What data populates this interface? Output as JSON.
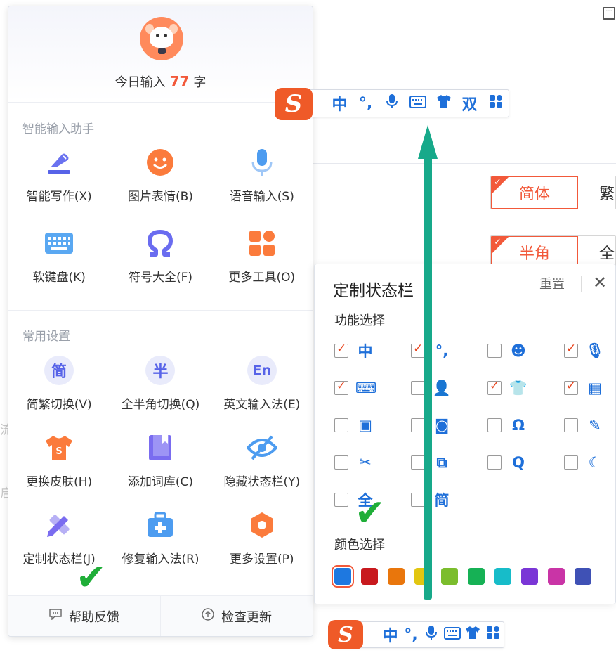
{
  "background": {
    "simp_trad": {
      "active": "简体",
      "inactive": "繁"
    },
    "half_full": {
      "active": "半角",
      "inactive": "全"
    },
    "edge_texts": [
      "流",
      "启"
    ]
  },
  "menu": {
    "today_prefix": "今日输入",
    "today_count": "77",
    "today_suffix": "字",
    "assistant_title": "智能输入助手",
    "assistant_tools": [
      {
        "label": "智能写作(X)",
        "icon": "pen-icon"
      },
      {
        "label": "图片表情(B)",
        "icon": "smiley-icon"
      },
      {
        "label": "语音输入(S)",
        "icon": "microphone-icon"
      },
      {
        "label": "软键盘(K)",
        "icon": "keyboard-icon"
      },
      {
        "label": "符号大全(F)",
        "icon": "omega-icon"
      },
      {
        "label": "更多工具(O)",
        "icon": "grid-icon"
      }
    ],
    "settings_title": "常用设置",
    "settings_tools": [
      {
        "label": "简繁切换(V)",
        "icon_text": "简"
      },
      {
        "label": "全半角切换(Q)",
        "icon_text": "半"
      },
      {
        "label": "英文输入法(E)",
        "icon_text": "En"
      },
      {
        "label": "更换皮肤(H)",
        "icon": "tshirt-icon"
      },
      {
        "label": "添加词库(C)",
        "icon": "book-icon"
      },
      {
        "label": "隐藏状态栏(Y)",
        "icon": "eye-off-icon"
      },
      {
        "label": "定制状态栏(J)",
        "icon": "ruler-pencil-icon"
      },
      {
        "label": "修复输入法(R)",
        "icon": "toolbox-icon"
      },
      {
        "label": "更多设置(P)",
        "icon": "hexagon-icon"
      }
    ],
    "footer": {
      "help": "帮助反馈",
      "update": "检查更新"
    }
  },
  "statusbar_top": {
    "logo": "S",
    "items": [
      "中",
      "°,",
      "mic",
      "kbd",
      "shirt",
      "双",
      "grid"
    ]
  },
  "statusbar_bottom": {
    "logo": "S",
    "items": [
      "中",
      "°,",
      "mic",
      "kbd",
      "shirt",
      "grid"
    ]
  },
  "customize": {
    "title": "定制状态栏",
    "reset": "重置",
    "close": "✕",
    "function_title": "功能选择",
    "color_title": "颜色选择",
    "options": [
      {
        "glyph": "中",
        "checked": true
      },
      {
        "glyph": "°,",
        "checked": true
      },
      {
        "glyph": "☻",
        "checked": false
      },
      {
        "glyph": "🎙",
        "checked": true
      },
      {
        "glyph": "⌨",
        "checked": true
      },
      {
        "glyph": "👤",
        "checked": false
      },
      {
        "glyph": "👕",
        "checked": true
      },
      {
        "glyph": "▦",
        "checked": true
      },
      {
        "glyph": "▣",
        "checked": false
      },
      {
        "glyph": "◙",
        "checked": false
      },
      {
        "glyph": "Ω",
        "checked": false
      },
      {
        "glyph": "✎",
        "checked": false
      },
      {
        "glyph": "✂",
        "checked": false
      },
      {
        "glyph": "⧉",
        "checked": false
      },
      {
        "glyph": "Q",
        "checked": false
      },
      {
        "glyph": "☾",
        "checked": false
      },
      {
        "glyph": "全",
        "checked": false
      },
      {
        "glyph": "简",
        "checked": false
      }
    ],
    "colors": [
      "#1e78e0",
      "#c8191e",
      "#e9760c",
      "#e2c611",
      "#7bbd2d",
      "#16b155",
      "#17bcc9",
      "#7a36d6",
      "#c934a6",
      "#3f51b5"
    ],
    "selected_color": "#1e78e0"
  },
  "colors": {
    "accent": "#f2593a",
    "brand_blue": "#1e6fd9",
    "arrow_green": "#17a98a",
    "check_green": "#1fae38"
  }
}
